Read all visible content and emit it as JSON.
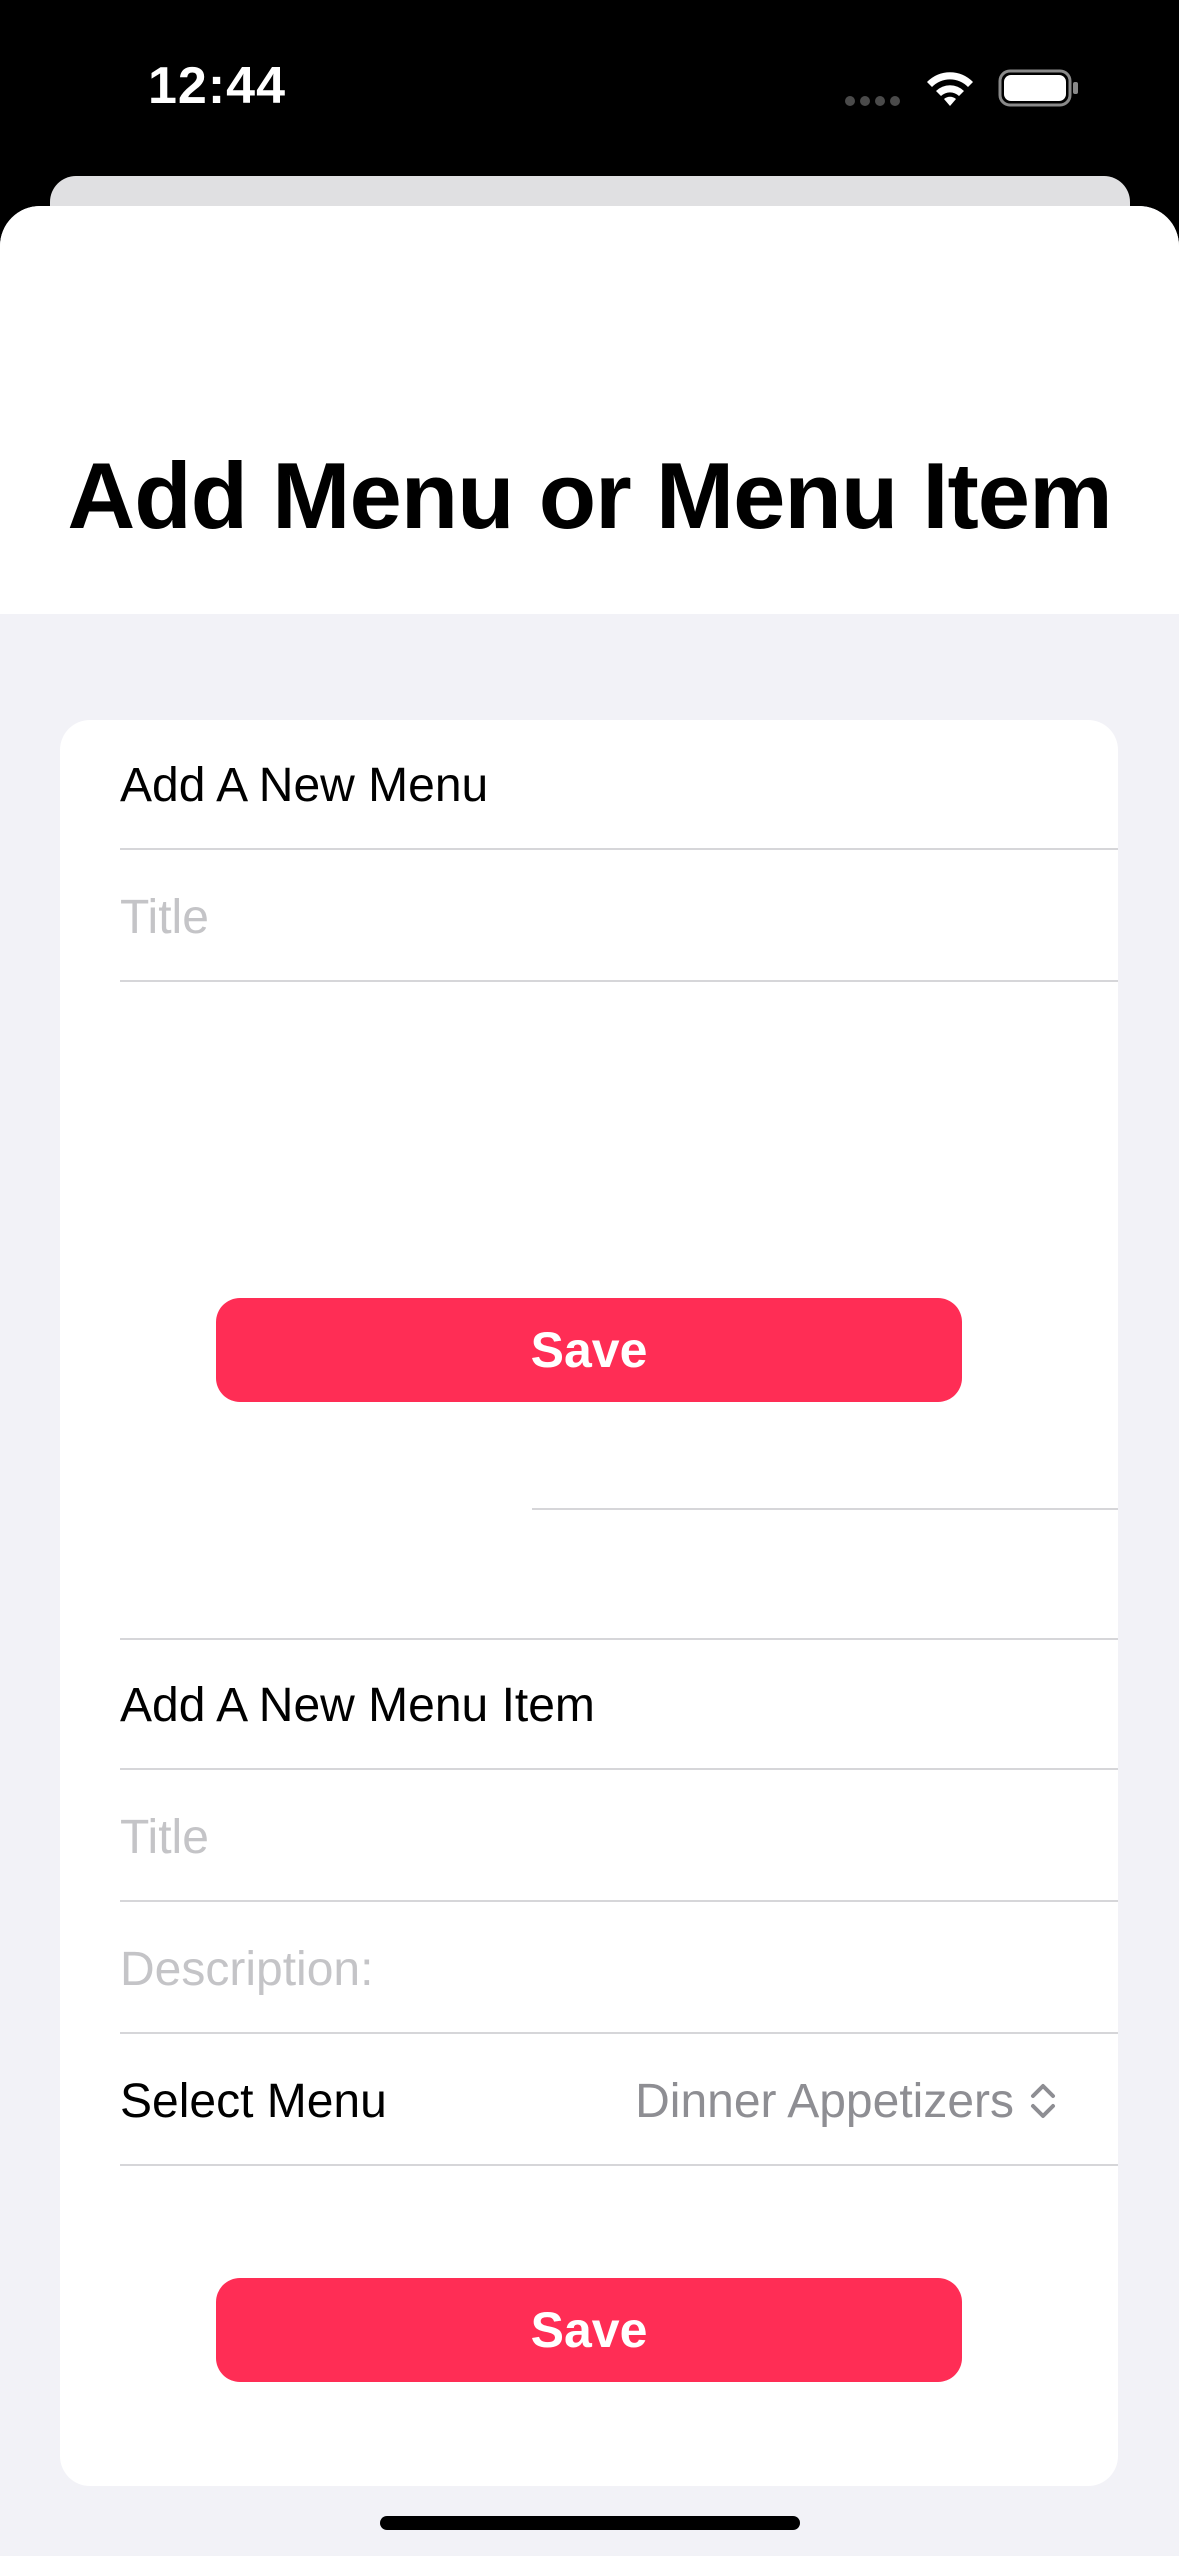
{
  "status_bar": {
    "time": "12:44",
    "wifi_icon": "wifi-icon",
    "battery_icon": "battery-icon"
  },
  "page": {
    "title": "Add Menu or Menu Item"
  },
  "menu_section": {
    "header": "Add A New Menu",
    "title_placeholder": "Title",
    "save_label": "Save"
  },
  "menu_item_section": {
    "header": "Add A New Menu Item",
    "title_placeholder": "Title",
    "description_placeholder": "Description:",
    "select_label": "Select Menu",
    "select_value": "Dinner Appetizers",
    "select_icon": "chevron-up-down-icon",
    "save_label": "Save"
  },
  "colors": {
    "accent": "#ff2d55",
    "background": "#f2f2f7",
    "card": "#ffffff",
    "separator": "#d6d6d9",
    "placeholder": "#c4c4c7"
  }
}
